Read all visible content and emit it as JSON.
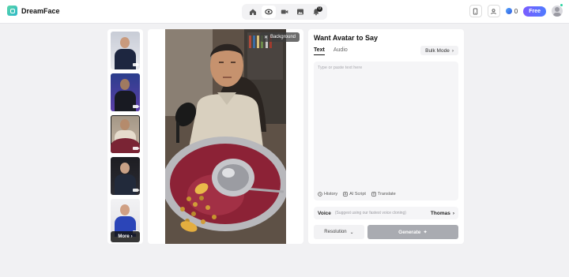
{
  "app": {
    "name": "DreamFace"
  },
  "nav": {
    "badge": "0"
  },
  "account": {
    "credits": "0",
    "plan_label": "Free"
  },
  "thumbnails": {
    "more_label": "More"
  },
  "preview": {
    "background_label": "Background"
  },
  "editor": {
    "title": "Want Avatar to Say",
    "tabs": [
      "Text",
      "Audio"
    ],
    "bulk_mode_label": "Bulk Mode",
    "text_placeholder": "Type or paste text here",
    "tools": [
      "History",
      "AI Script",
      "Translate"
    ],
    "voice": {
      "label": "Voice",
      "hint": "(Suggest using our fastest voice cloning)",
      "selected": "Thomas"
    },
    "resolution_label": "Resolution",
    "generate_label": "Generate"
  },
  "colors": {
    "accent": "#5b6cff",
    "generate_disabled": "#a9abb1",
    "brand": "#2bb6c9"
  },
  "icons": [
    "home-icon",
    "eye-icon",
    "video-camera-icon",
    "image-icon",
    "bell-icon",
    "phone-icon",
    "user-id-icon",
    "coin-icon",
    "user-avatar-icon",
    "close-icon",
    "chevron-right-icon",
    "history-icon",
    "ai-script-icon",
    "translate-icon",
    "chevron-down-icon",
    "sparkle-icon"
  ]
}
